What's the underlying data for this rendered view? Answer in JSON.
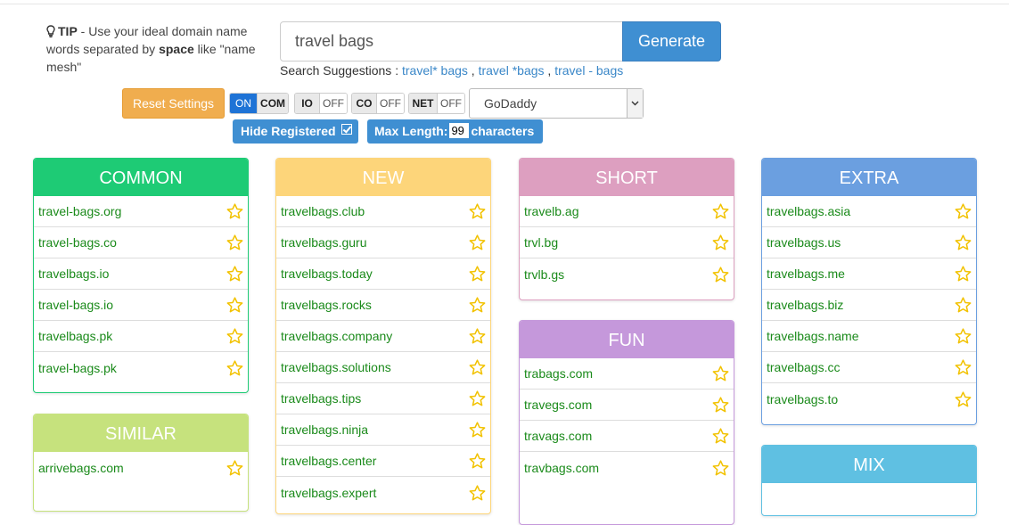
{
  "tip": {
    "label": "TIP",
    "text_1": " - Use your ideal domain name words separated by ",
    "bold_word": "space",
    "text_2": " like \"name mesh\""
  },
  "search": {
    "value": "travel bags",
    "button": "Generate",
    "suggestions_label": "Search Suggestions : ",
    "suggestions": [
      "travel* bags",
      "travel *bags",
      "travel - bags"
    ]
  },
  "settings": {
    "reset": "Reset Settings",
    "toggles": [
      {
        "ext": "COM",
        "state": "ON"
      },
      {
        "ext": "IO",
        "state": "OFF"
      },
      {
        "ext": "CO",
        "state": "OFF"
      },
      {
        "ext": "NET",
        "state": "OFF"
      }
    ],
    "registrar": "GoDaddy",
    "hide_registered": "Hide Registered",
    "max_length_label": "Max Length:",
    "max_length_value": "99",
    "max_length_suffix": "characters"
  },
  "panels": {
    "common": {
      "title": "COMMON",
      "color": "#1ecb75",
      "items": [
        "travel-bags.org",
        "travel-bags.co",
        "travelbags.io",
        "travel-bags.io",
        "travelbags.pk",
        "travel-bags.pk"
      ]
    },
    "similar": {
      "title": "SIMILAR",
      "color": "#c6e27d",
      "items": [
        "arrivebags.com"
      ]
    },
    "new": {
      "title": "NEW",
      "color": "#fdd57a",
      "items": [
        "travelbags.club",
        "travelbags.guru",
        "travelbags.today",
        "travelbags.rocks",
        "travelbags.company",
        "travelbags.solutions",
        "travelbags.tips",
        "travelbags.ninja",
        "travelbags.center",
        "travelbags.expert"
      ]
    },
    "short": {
      "title": "SHORT",
      "color": "#dd9fc0",
      "items": [
        "travelb.ag",
        "trvl.bg",
        "trvlb.gs"
      ]
    },
    "fun": {
      "title": "FUN",
      "color": "#c598db",
      "items": [
        "trabags.com",
        "travegs.com",
        "travags.com",
        "travbags.com"
      ]
    },
    "extra": {
      "title": "EXTRA",
      "color": "#6b9fe0",
      "items": [
        "travelbags.asia",
        "travelbags.us",
        "travelbags.me",
        "travelbags.biz",
        "travelbags.name",
        "travelbags.cc",
        "travelbags.to"
      ]
    },
    "mix": {
      "title": "MIX",
      "color": "#5fc0e2",
      "items": []
    }
  }
}
